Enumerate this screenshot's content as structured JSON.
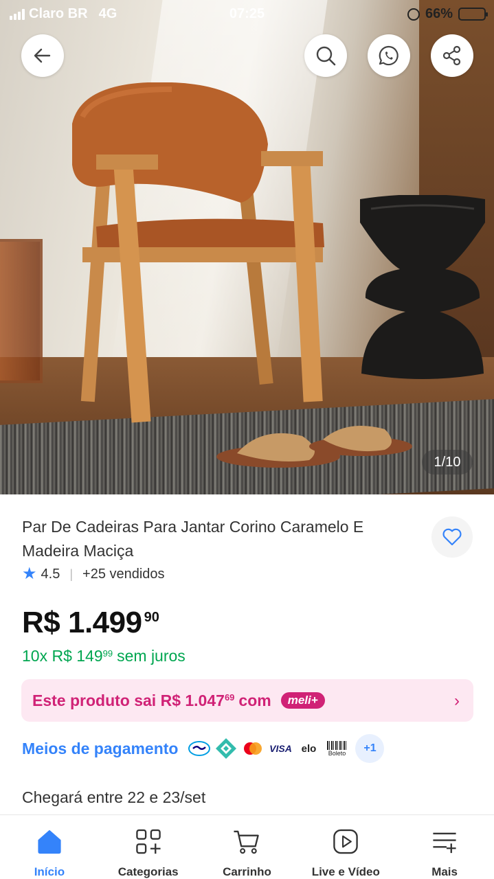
{
  "status_bar": {
    "carrier": "Claro BR",
    "network": "4G",
    "time": "07:25",
    "battery": "66%",
    "battery_level": 0.66
  },
  "gallery": {
    "counter": "1/10",
    "image_icon": "chair-product-photo"
  },
  "header_buttons": {
    "back_icon": "arrow-left-icon",
    "search_icon": "search-icon",
    "whatsapp_icon": "whatsapp-icon",
    "share_icon": "share-icon"
  },
  "product": {
    "title": "Par De Cadeiras Para Jantar Corino Caramelo E Madeira Maciça",
    "rating": "4.5",
    "sold": "+25 vendidos",
    "price_main": "R$ 1.499",
    "price_cents": "90",
    "installments_prefix": "10x R$ 149",
    "installments_cents": "99",
    "installments_suffix": "sem juros"
  },
  "meli_banner": {
    "text_prefix": "Este produto sai R$ 1.047",
    "text_cents": "69",
    "text_suffix": "com",
    "badge": "meli+"
  },
  "payments": {
    "label": "Meios de pagamento",
    "visa": "VISA",
    "elo": "elo",
    "boleto": "Boleto",
    "more": "+1"
  },
  "delivery": {
    "text": "Chegará entre 22 e 23/set"
  },
  "bottom_nav": {
    "items": [
      {
        "label": "Início",
        "icon": "home-icon"
      },
      {
        "label": "Categorias",
        "icon": "categories-icon"
      },
      {
        "label": "Carrinho",
        "icon": "cart-icon"
      },
      {
        "label": "Live e Vídeo",
        "icon": "play-icon"
      },
      {
        "label": "Mais",
        "icon": "menu-plus-icon"
      }
    ]
  },
  "colors": {
    "accent": "#3483fa",
    "green": "#00a650",
    "meli_pink": "#d02276",
    "meli_bg": "#fde8f2"
  }
}
